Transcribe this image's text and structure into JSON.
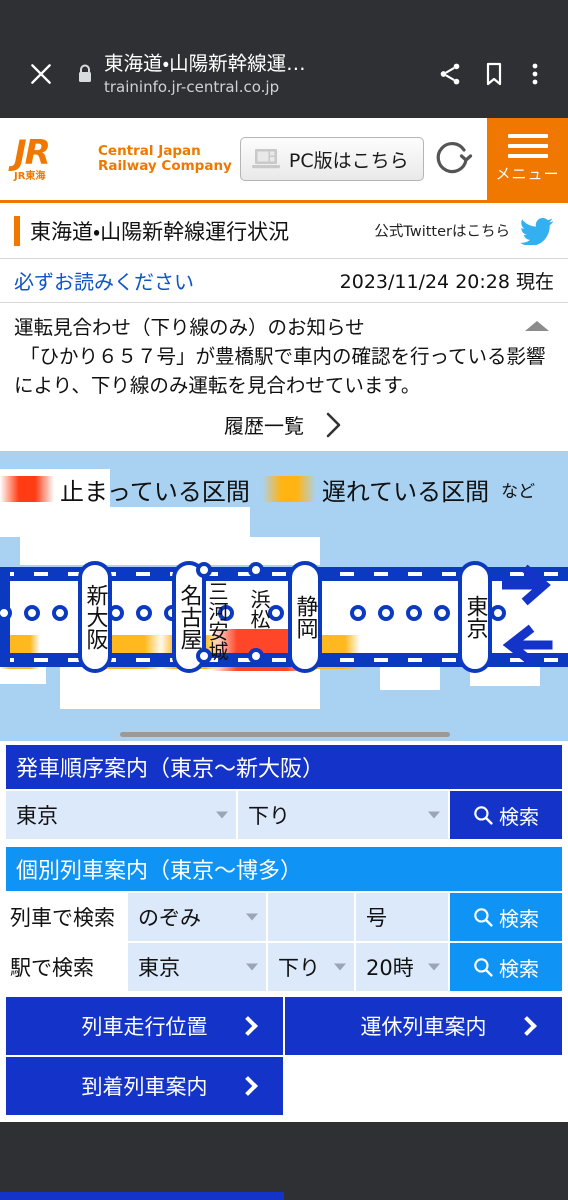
{
  "browser": {
    "title": "東海道・山陽新幹線運…",
    "url": "traininfo.jr-central.co.jp",
    "close_icon": "close-icon",
    "lock_icon": "lock-icon",
    "share_icon": "share-icon",
    "bookmark_icon": "bookmark-icon",
    "overflow_icon": "more-vertical-icon"
  },
  "site_header": {
    "logo_mark": "JR",
    "logo_sub": "JR東海",
    "company_line1": "Central Japan",
    "company_line2": "Railway Company",
    "pc_button": "PC版はこちら",
    "pc_icon": "laptop-icon",
    "reload_icon": "reload-icon",
    "menu_icon": "hamburger-icon",
    "menu_label": "メニュー",
    "accent_color": "#f07800"
  },
  "page_header": {
    "title": "東海道・山陽新幹線運行状況",
    "twitter_label": "公式Twitterはこちら",
    "twitter_icon": "twitter-bird-icon",
    "read_link": "必ずお読みください",
    "timestamp": "2023/11/24 20:28 現在"
  },
  "notice": {
    "heading": "運転見合わせ（下り線のみ）のお知らせ",
    "body_line1": "「ひかり６５７号」が豊橋駅で車内の確認を行っている影響",
    "body_line2": "により、下り線のみ運転を見合わせています。",
    "collapse_icon": "triangle-up-icon",
    "history_label": "履歴一覧",
    "history_chevron": "chevron-right-icon"
  },
  "legend": {
    "stopped_label": "止まっている区間",
    "stopped_color": "#ff3c14",
    "delayed_label": "遅れている区間",
    "delayed_color": "#ffb81e",
    "etc_label": "など"
  },
  "map": {
    "major_stations": [
      "新大阪",
      "名古屋",
      "静岡",
      "東京"
    ],
    "minor_labels": [
      "三河安城",
      "浜松"
    ],
    "up_arrow_icon": "arrow-right-icon",
    "down_arrow_icon": "arrow-left-icon",
    "rail_color": "#0b39c0",
    "sea_color": "#a9d2f2",
    "scrollbar": "horizontal-scrollbar"
  },
  "departure_panel": {
    "heading": "発車順序案内（東京〜新大阪）",
    "station_value": "東京",
    "direction_value": "下り",
    "search_label": "検索",
    "search_icon": "search-icon"
  },
  "train_panel": {
    "heading": "個別列車案内（東京〜博多）",
    "row_train_label": "列車で検索",
    "train_type_value": "のぞみ",
    "train_number_value": "",
    "train_number_unit": "号",
    "row_station_label": "駅で検索",
    "station_value": "東京",
    "direction_value": "下り",
    "hour_value": "20時",
    "search_label": "検索",
    "search_icon": "search-icon"
  },
  "nav_buttons": [
    {
      "label": "列車走行位置",
      "icon": "chevron-right-icon"
    },
    {
      "label": "運休列車案内",
      "icon": "chevron-right-icon"
    },
    {
      "label": "到着列車案内",
      "icon": "chevron-right-icon"
    }
  ]
}
